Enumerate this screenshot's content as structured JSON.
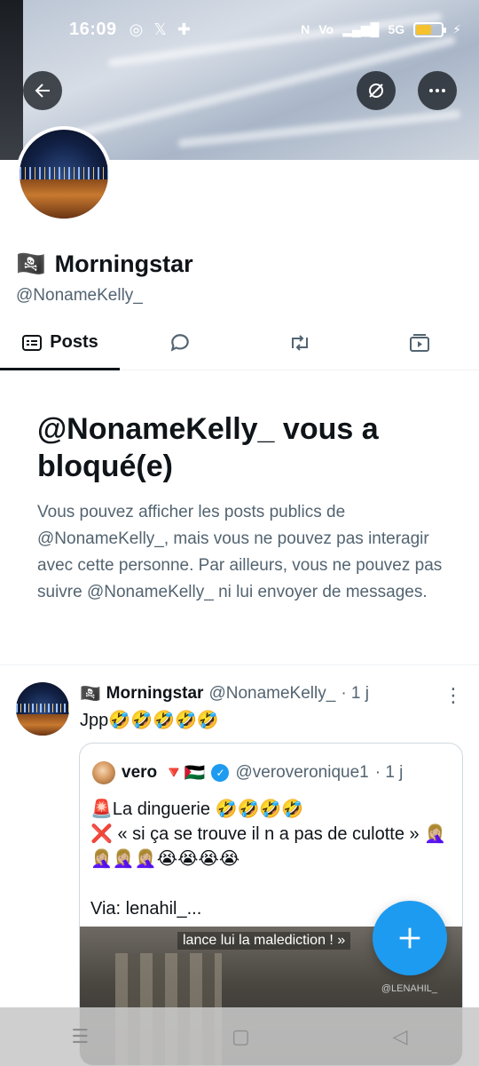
{
  "status_bar": {
    "time": "16:09",
    "network": "5G"
  },
  "profile": {
    "name": "Morningstar",
    "name_emoji": "🏴‍☠️",
    "handle": "@NonameKelly_"
  },
  "tabs": [
    {
      "label": "Posts",
      "icon": "posts-icon"
    },
    {
      "label": "",
      "icon": "replies-icon"
    },
    {
      "label": "",
      "icon": "retweet-icon"
    },
    {
      "label": "",
      "icon": "media-icon"
    }
  ],
  "blocked": {
    "title": "@NonameKelly_ vous a bloqué(e)",
    "message": "Vous pouvez afficher les posts publics de @NonameKelly_, mais vous ne pouvez pas interagir avec cette personne. Par ailleurs, vous ne pouvez pas suivre @NonameKelly_ ni lui envoyer de messages."
  },
  "post": {
    "author": "Morningstar",
    "author_emoji": "🏴‍☠️",
    "handle": "@NonameKelly_",
    "time": "· 1 j",
    "text": "Jpp🤣🤣🤣🤣🤣",
    "quote": {
      "author": "vero",
      "flags": "🔻🇵🇸",
      "handle": "@veroveronique1",
      "time": "· 1 j",
      "text": "🚨La dinguerie 🤣🤣🤣🤣\n❌ « si ça se trouve il n a pas de culotte » 🤦🏼‍♀️🤦🏼‍♀️🤦🏼‍♀️🤦🏼‍♀️😭😭😭😭\n\nVia: lenahil_...",
      "media_caption": "lance lui la malediction ! »",
      "media_watermark": "@LENAHIL_"
    }
  },
  "colors": {
    "accent": "#1d9bf0",
    "text": "#0f1419",
    "muted": "#536471"
  }
}
